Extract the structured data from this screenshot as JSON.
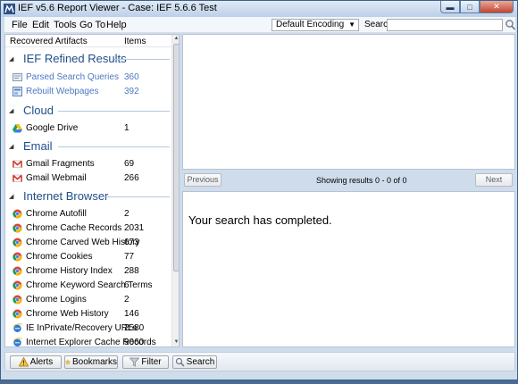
{
  "window": {
    "title": "IEF v5.6 Report Viewer - Case: IEF 5.6.6 Test",
    "min_glyph": "▬",
    "max_glyph": "□",
    "close_glyph": "✕"
  },
  "menu": [
    "File",
    "Edit",
    "Tools",
    "Go To",
    "Help"
  ],
  "toolbar": {
    "encoding": "Default Encoding",
    "encoding_arrow": "▼",
    "search_label": "Search:",
    "search_value": ""
  },
  "left_panel": {
    "header": {
      "col1": "Recovered Artifacts",
      "col2": "Items"
    },
    "scroll_up": "▲",
    "scroll_down": "▼",
    "expand_glyph": "◢",
    "categories": [
      {
        "name": "IEF Refined Results",
        "items": [
          {
            "label": "Parsed Search Queries",
            "count": "360",
            "icon": "search-query-icon"
          },
          {
            "label": "Rebuilt Webpages",
            "count": "392",
            "icon": "webpage-icon"
          }
        ]
      },
      {
        "name": "Cloud",
        "items": [
          {
            "label": "Google Drive",
            "count": "1",
            "icon": "google-drive-icon"
          }
        ]
      },
      {
        "name": "Email",
        "items": [
          {
            "label": "Gmail Fragments",
            "count": "69",
            "icon": "gmail-icon"
          },
          {
            "label": "Gmail Webmail",
            "count": "266",
            "icon": "gmail-icon"
          }
        ]
      },
      {
        "name": "Internet Browser",
        "items": [
          {
            "label": "Chrome Autofill",
            "count": "2",
            "icon": "chrome-icon"
          },
          {
            "label": "Chrome Cache Records",
            "count": "2031",
            "icon": "chrome-icon"
          },
          {
            "label": "Chrome Carved Web History",
            "count": "673",
            "icon": "chrome-icon"
          },
          {
            "label": "Chrome Cookies",
            "count": "77",
            "icon": "chrome-icon"
          },
          {
            "label": "Chrome History Index",
            "count": "288",
            "icon": "chrome-icon"
          },
          {
            "label": "Chrome Keyword Search Terms",
            "count": "6",
            "icon": "chrome-icon"
          },
          {
            "label": "Chrome Logins",
            "count": "2",
            "icon": "chrome-icon"
          },
          {
            "label": "Chrome Web History",
            "count": "146",
            "icon": "chrome-icon"
          },
          {
            "label": "IE InPrivate/Recovery URLs",
            "count": "2580",
            "icon": "ie-icon"
          },
          {
            "label": "Internet Explorer Cache Records",
            "count": "9060",
            "icon": "ie-icon"
          }
        ]
      }
    ]
  },
  "results_nav": {
    "previous": "Previous",
    "next": "Next",
    "status": "Showing results 0 - 0 of 0"
  },
  "detail": {
    "message": "Your search has completed."
  },
  "bottom_buttons": {
    "alerts": "Alerts",
    "bookmarks": "Bookmarks",
    "filter": "Filter",
    "search": "Search"
  },
  "colors": {
    "category_text": "#1f4e8a",
    "refined_link": "#4d78c2",
    "window_frame": "#cfdcec"
  }
}
